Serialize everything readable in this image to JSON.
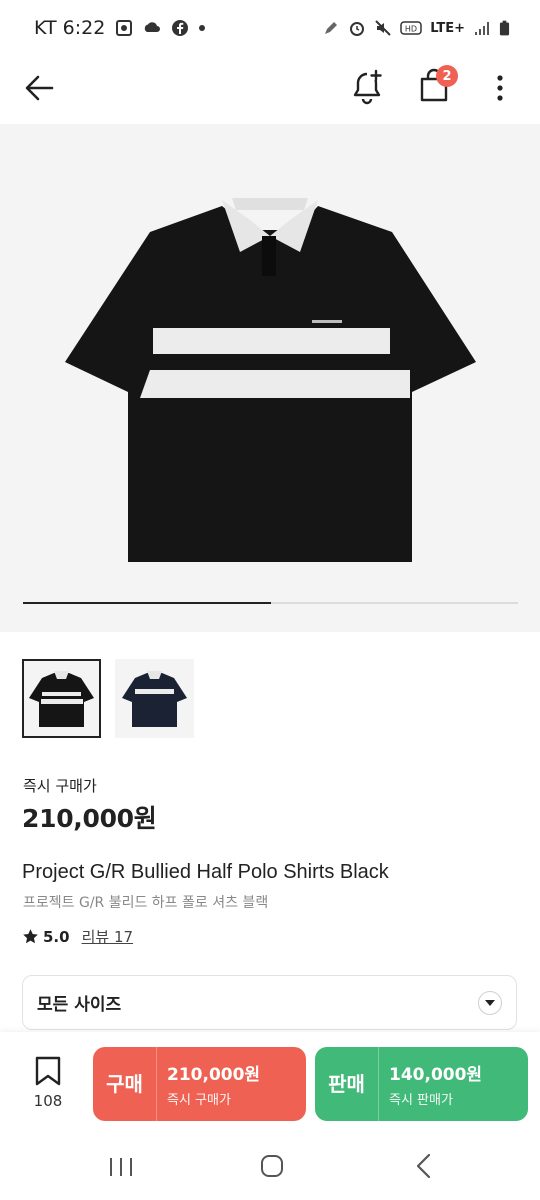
{
  "status_bar": {
    "carrier_time": "KT 6:22",
    "network": "LTE+"
  },
  "app_bar": {
    "cart_badge": "2",
    "icons": [
      "back-arrow-icon",
      "bell-plus-icon",
      "shopping-bag-icon",
      "more-vertical-icon"
    ]
  },
  "gallery": {
    "progress": 0.5,
    "thumbnails": [
      "black",
      "navy"
    ],
    "colors": {
      "shirt_black": "#151515",
      "shirt_navy": "#1a2233",
      "stripe": "#ececec"
    }
  },
  "price_section": {
    "label": "즉시 구매가",
    "price": "210,000원"
  },
  "product": {
    "name_en": "Project G/R Bullied Half Polo Shirts Black",
    "name_ko": "프로젝트 G/R 불리드 하프 폴로 셔츠 블랙",
    "rating": "5.0",
    "review_link": "리뷰 17"
  },
  "size_selector": {
    "label": "모든 사이즈"
  },
  "action_bar": {
    "wish_count": "108",
    "buy": {
      "type": "구매",
      "price": "210,000원",
      "sub": "즉시 구매가",
      "color": "#ef6253"
    },
    "sell": {
      "type": "판매",
      "price": "140,000원",
      "sub": "즉시 판매가",
      "color": "#41b979"
    }
  }
}
